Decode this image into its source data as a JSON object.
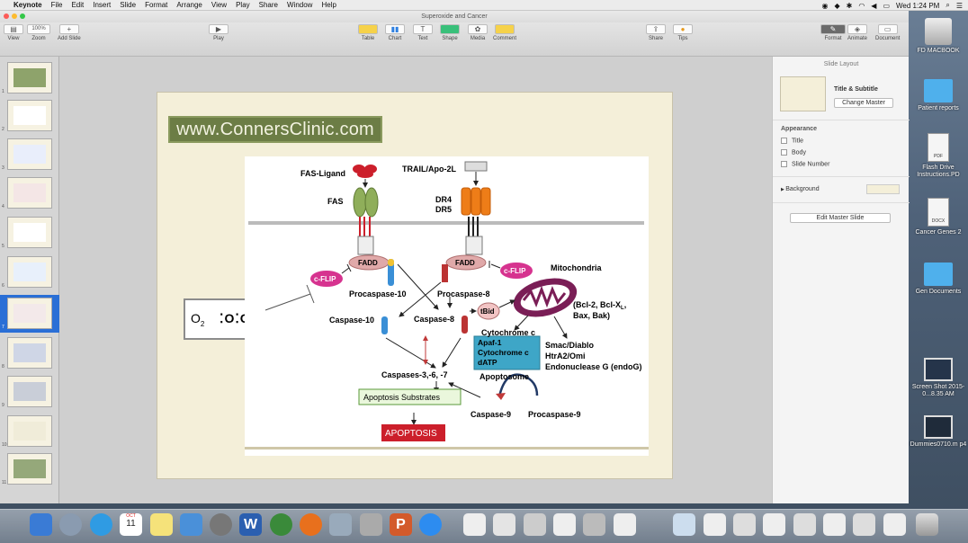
{
  "menubar": {
    "app": "Keynote",
    "items": [
      "File",
      "Edit",
      "Insert",
      "Slide",
      "Format",
      "Arrange",
      "View",
      "Play",
      "Share",
      "Window",
      "Help"
    ],
    "clock": "Wed 1:24 PM"
  },
  "window": {
    "title": "Superoxide and Cancer"
  },
  "toolbar": {
    "view": "View",
    "zoom_value": "100%",
    "zoom": "Zoom",
    "add_slide": "Add Slide",
    "play": "Play",
    "table": "Table",
    "chart": "Chart",
    "text": "Text",
    "shape": "Shape",
    "media": "Media",
    "comment": "Comment",
    "share": "Share",
    "tips": "Tips",
    "format": "Format",
    "animate": "Animate",
    "document": "Document"
  },
  "navigator": {
    "selected_slide": 7,
    "slide_numbers": [
      "1",
      "2",
      "3",
      "4",
      "5",
      "6",
      "7",
      "8",
      "9",
      "10",
      "11"
    ]
  },
  "slide": {
    "banner": "www.ConnersClinic.com",
    "o2_label": "O",
    "o2_sub": "2",
    "dots_label": "⁚O⁚O⁚"
  },
  "diagram": {
    "fas_ligand": "FAS-Ligand",
    "trail": "TRAIL/Apo-2L",
    "fas": "FAS",
    "dr4": "DR4",
    "dr5": "DR5",
    "fadd_left": "FADD",
    "fadd_right": "FADD",
    "cflip_left": "c-FLIP",
    "cflip_right": "c-FLIP",
    "mitochondria": "Mitochondria",
    "procaspase10": "Procaspase-10",
    "procaspase8": "Procaspase-8",
    "bcl_line1": "(Bcl-2, Bcl-X",
    "bcl_sub": "L",
    "bcl_end": ",",
    "bcl_line2": "Bax, Bak)",
    "tbid": "tBid",
    "caspase10": "Caspase-10",
    "caspase8": "Caspase-8",
    "cytochrome_c": "Cytochrome c",
    "apaf_line1": "Apaf-1",
    "apaf_line2": "Cytochrome c",
    "apaf_line3": "dATP",
    "smac": "Smac/Diablo",
    "htra2": "HtrA2/Omi",
    "endonuclease": "Endonuclease G (endoG)",
    "apoptosome": "Apoptosome",
    "caspases": "Caspases-3,-6, -7",
    "substrates": "Apoptosis Substrates",
    "caspase9": "Caspase-9",
    "procaspase9": "Procaspase-9",
    "apoptosis": "APOPTOSIS"
  },
  "inspector": {
    "header": "Slide Layout",
    "layout_name": "Title & Subtitle",
    "change_master": "Change Master",
    "appearance": "Appearance",
    "title_opt": "Title",
    "body_opt": "Body",
    "slide_number_opt": "Slide Number",
    "background": "Background",
    "edit_master": "Edit Master Slide"
  },
  "desktop": {
    "icons": [
      "FD MACBOOK",
      "Patient reports",
      "Flash Drive Instructions.PD",
      "Cancer Genes 2",
      "Gen Documents",
      "Screen Shot 2015-0...8.35 AM",
      "Dummies0710.m p4"
    ],
    "pdf_tag": "PDF",
    "docx_tag": "DOCX"
  },
  "dock": {
    "calendar_month": "OCT",
    "calendar_day": "11"
  },
  "colors": {
    "accent": "#2a6fd6",
    "banner": "#6c7d45",
    "apoptosis": "#cc1f2b",
    "apaf_box": "#3ea6c7",
    "substrates_border": "#5a9a3a"
  }
}
